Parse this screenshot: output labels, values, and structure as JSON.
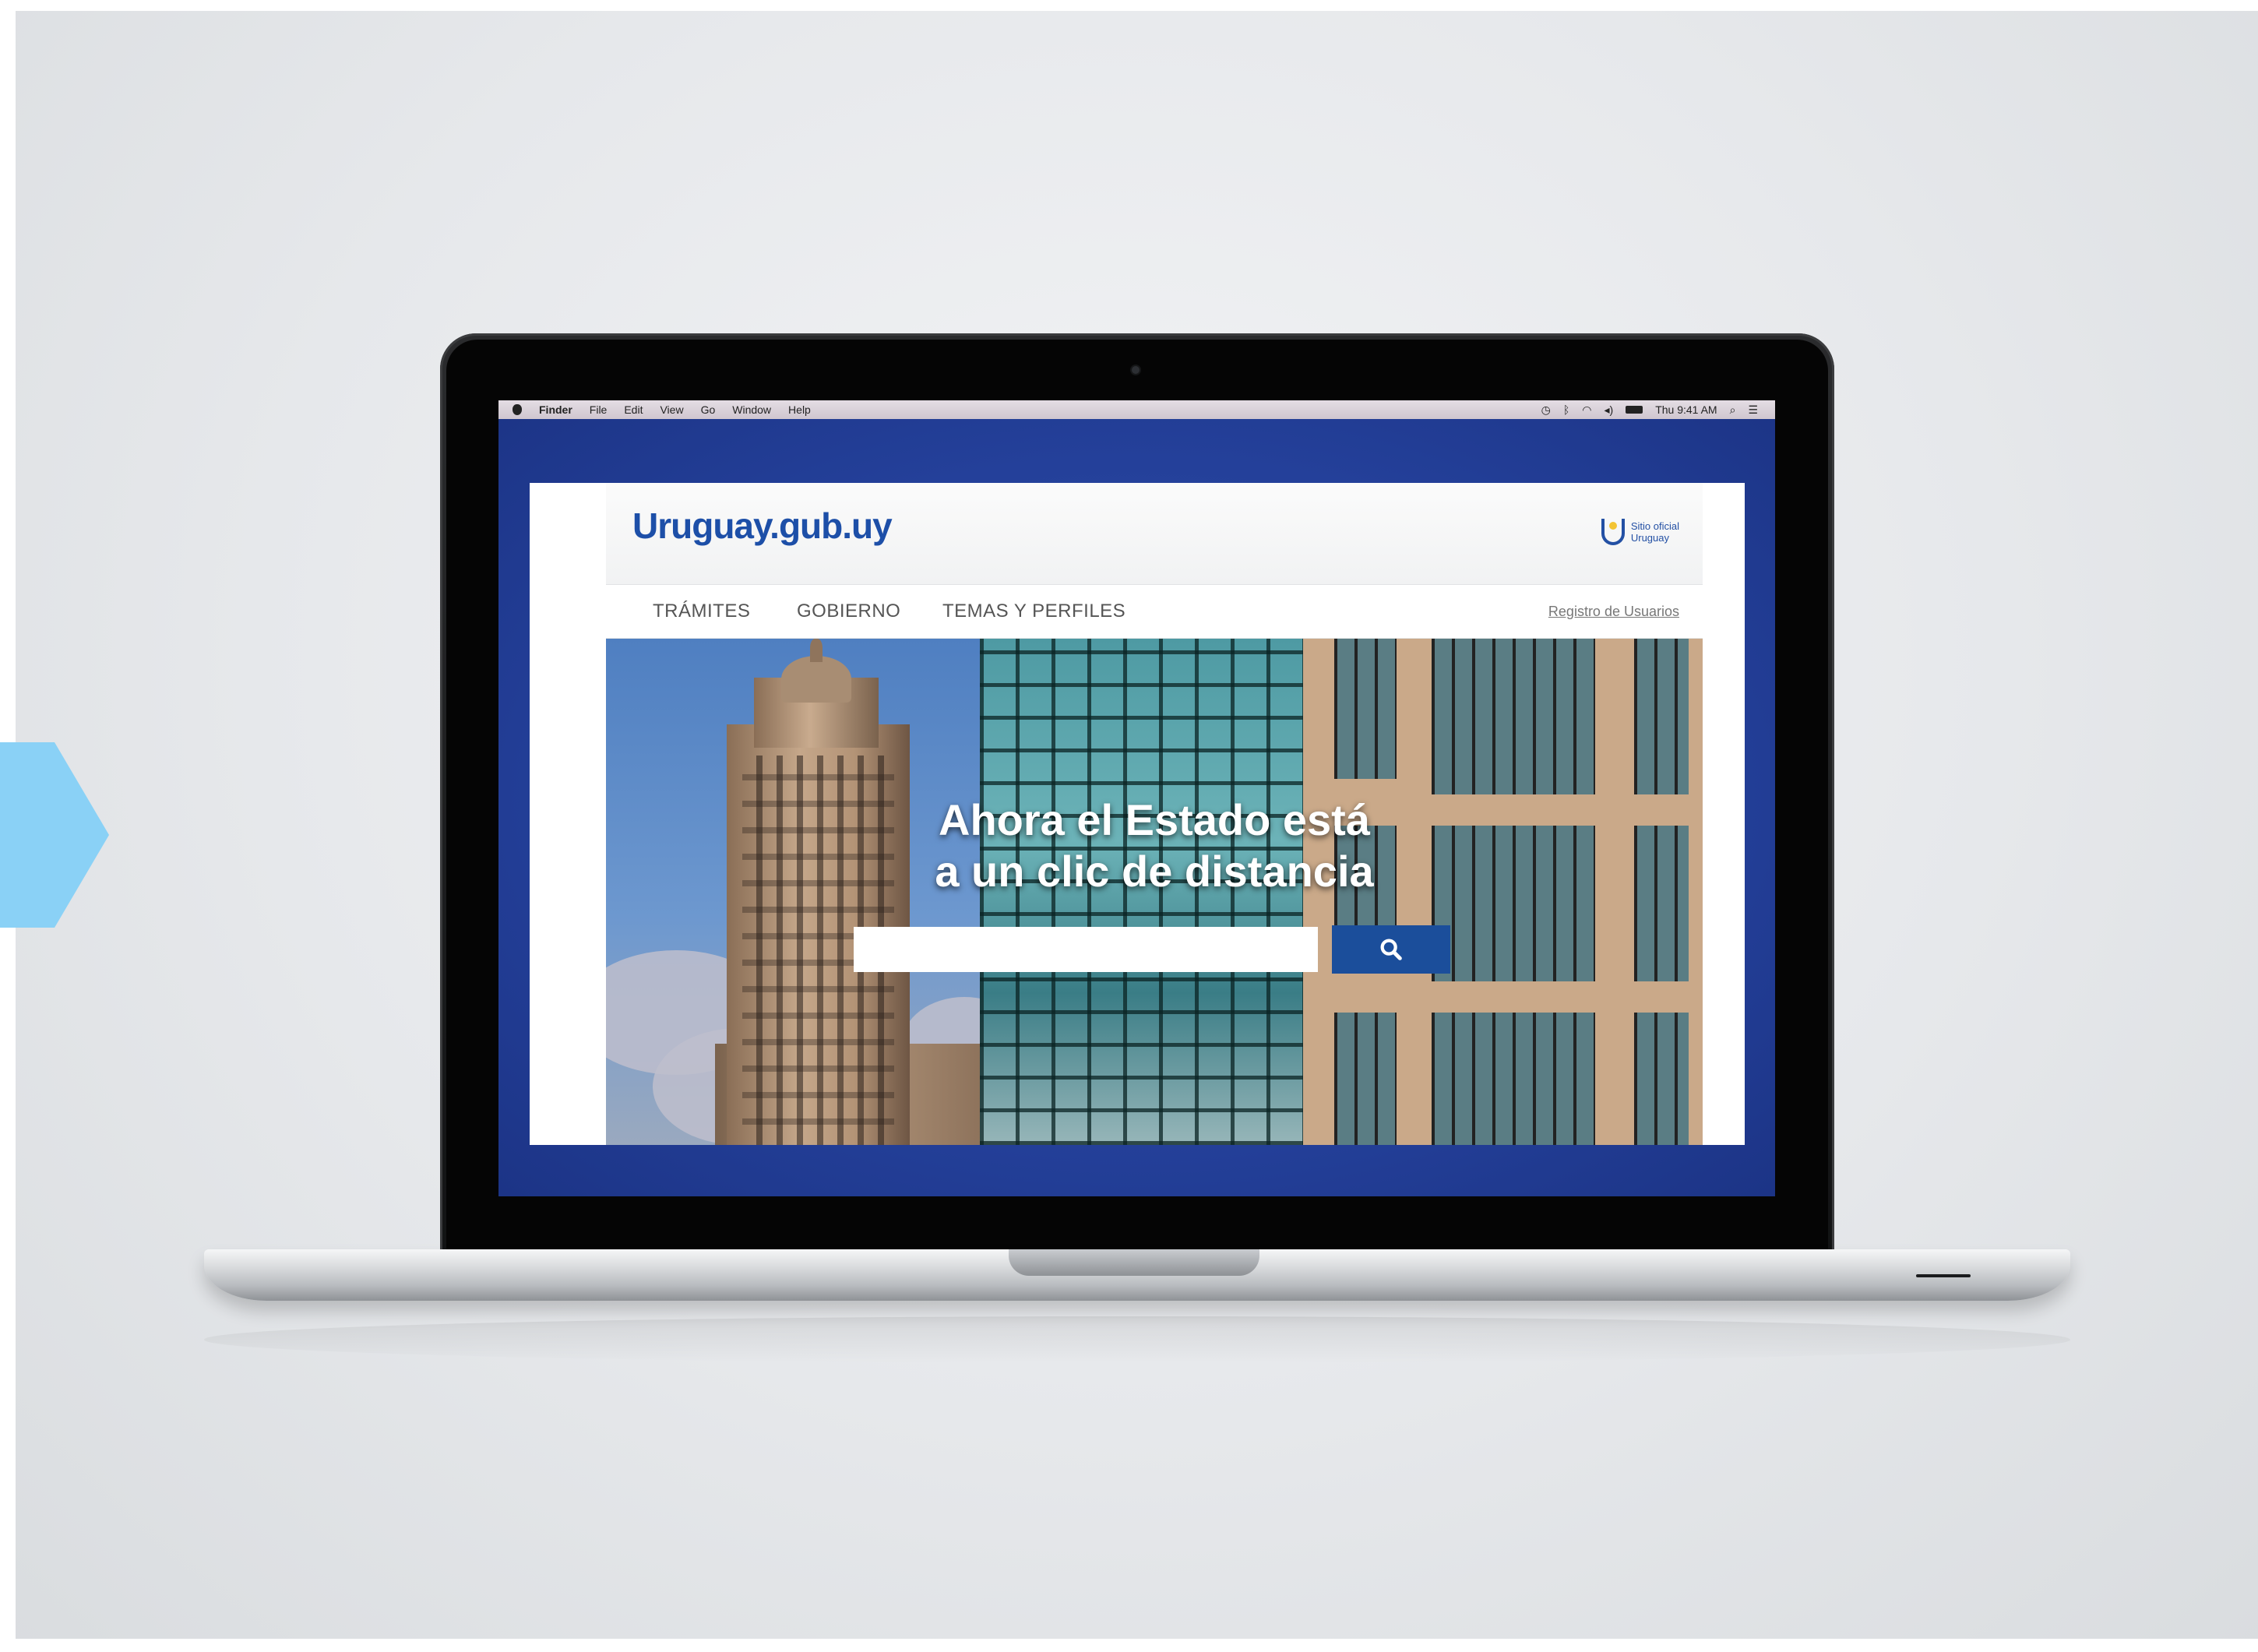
{
  "menubar": {
    "app": "Finder",
    "items": [
      "File",
      "Edit",
      "View",
      "Go",
      "Window",
      "Help"
    ],
    "clock": "Thu 9:41 AM"
  },
  "site": {
    "logo": "Uruguay.gub.uy",
    "official_line1": "Sitio oficial",
    "official_line2": "Uruguay",
    "nav": [
      "TRÁMITES",
      "GOBIERNO",
      "TEMAS Y PERFILES"
    ],
    "nav_right": "Registro de Usuarios"
  },
  "hero": {
    "title_line1": "Ahora el Estado está",
    "title_line2": "a un clic de distancia",
    "search_placeholder": ""
  },
  "colors": {
    "brand_blue": "#1d4fa8",
    "search_button": "#1b4e9b",
    "screen_background": "#24409a",
    "arrow": "#8ad1f6"
  },
  "icons": [
    "apple-icon",
    "clock-icon",
    "bluetooth-icon",
    "wifi-icon",
    "volume-icon",
    "battery-icon",
    "spotlight-icon",
    "notification-center-icon",
    "shield-icon",
    "search-icon"
  ]
}
